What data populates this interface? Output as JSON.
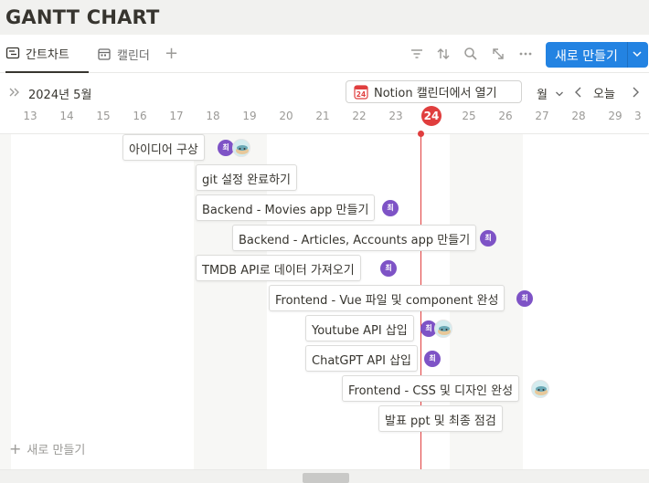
{
  "page": {
    "title": "GANTT CHART"
  },
  "views": {
    "tabs": [
      {
        "label": "간트차트",
        "active": true,
        "icon": "timeline-icon"
      },
      {
        "label": "캘린더",
        "active": false,
        "icon": "calendar-icon"
      }
    ],
    "add_label": "+",
    "tools": [
      "filter-icon",
      "sort-icon",
      "search-icon",
      "expand-icon",
      "more-icon"
    ],
    "new_button": "새로 만들기"
  },
  "header": {
    "month": "2024년 5월",
    "notion_button": "Notion 캘린더에서 열기",
    "notion_icon_text": "24",
    "range_select": "월",
    "today_label": "오늘"
  },
  "days": [
    "13",
    "14",
    "15",
    "16",
    "17",
    "18",
    "19",
    "20",
    "21",
    "22",
    "23",
    "24",
    "25",
    "26",
    "27",
    "28",
    "29",
    "3"
  ],
  "current_day": "24",
  "tasks": [
    {
      "title": "아이디어 구상",
      "assignees": [
        "최",
        "photo"
      ]
    },
    {
      "title": "git 설정 완료하기",
      "assignees": []
    },
    {
      "title": "Backend - Movies app 만들기",
      "assignees": [
        "최"
      ]
    },
    {
      "title": "Backend - Articles, Accounts app 만들기",
      "assignees": [
        "최"
      ]
    },
    {
      "title": "TMDB API로 데이터 가져오기",
      "assignees": [
        "최"
      ]
    },
    {
      "title": "Frontend - Vue 파일 및 component 완성",
      "assignees": [
        "최"
      ]
    },
    {
      "title": "Youtube API 삽입",
      "assignees": [
        "최",
        "photo"
      ]
    },
    {
      "title": "ChatGPT API 삽입",
      "assignees": [
        "최"
      ]
    },
    {
      "title": "Frontend - CSS 및 디자인 완성",
      "assignees": [
        "photo"
      ]
    },
    {
      "title": "발표 ppt 및 최종 점검",
      "assignees": []
    }
  ],
  "add_new": "새로 만들기",
  "colors": {
    "accent": "#2383e2",
    "today": "#e03e3e",
    "avatar": "#7e53c6"
  }
}
